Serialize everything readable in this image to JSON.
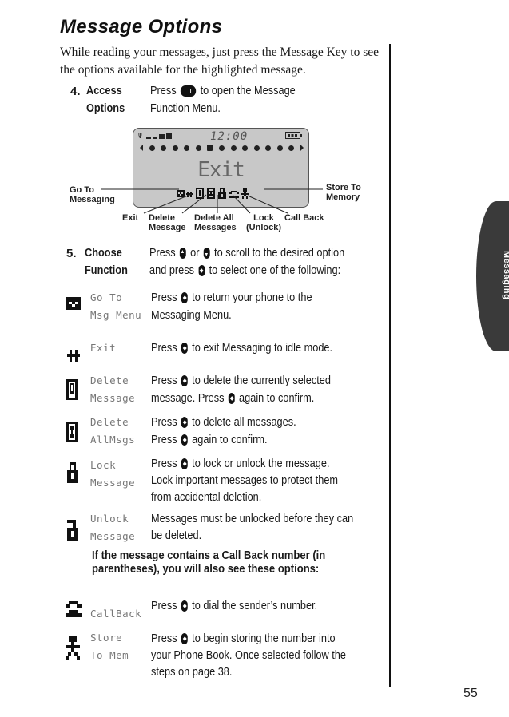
{
  "page": {
    "title": "Message Options",
    "intro": "While reading your messages, just press the Message Key to see the options available for the highlighted message.",
    "page_number": "55",
    "side_tab": "Messaging"
  },
  "step4": {
    "number": "4.",
    "label_line1": "Access",
    "label_line2": "Options",
    "text_before_key": "Press",
    "key_icon": "message-key-icon",
    "text_after_key": "to open the Message",
    "text_line2": "Function Menu."
  },
  "display": {
    "time": "12:00",
    "screen_text": "Exit",
    "callouts": {
      "go_to_messaging": [
        "Go To",
        "Messaging"
      ],
      "store_to_memory": [
        "Store To",
        "Memory"
      ],
      "exit": "Exit",
      "delete_message": [
        "Delete",
        "Message"
      ],
      "delete_all": [
        "Delete All",
        "Messages"
      ],
      "lock": [
        "Lock",
        "(Unlock)"
      ],
      "call_back": "Call Back"
    }
  },
  "step5": {
    "number": "5.",
    "label_line1": "Choose",
    "label_line2": "Function",
    "line1_a": "Press",
    "line1_b": "or",
    "line1_c": "to scroll to the desired option",
    "line2_a": "and press",
    "line2_b": "to select one of the following:"
  },
  "options": [
    {
      "icon": "go-to-messaging-icon",
      "lcd_line1": "Go To",
      "lcd_line2": "Msg Menu",
      "desc": [
        "Press",
        "to return your phone to the",
        "Messaging Menu."
      ]
    },
    {
      "icon": "exit-icon",
      "lcd_line1": "Exit",
      "lcd_line2": "",
      "desc": [
        "Press",
        "to exit Messaging to idle mode."
      ]
    },
    {
      "icon": "delete-message-icon",
      "lcd_line1": "Delete",
      "lcd_line2": "Message",
      "desc": [
        "Press",
        "to delete the currently selected",
        "message. Press",
        "again to confirm."
      ]
    },
    {
      "icon": "delete-all-icon",
      "lcd_line1": "Delete",
      "lcd_line2": "AllMsgs",
      "desc": [
        "Press",
        "to delete all messages.",
        "Press",
        "again to confirm."
      ]
    },
    {
      "icon": "lock-icon",
      "lcd_line1": "Lock",
      "lcd_line2": "Message",
      "desc": [
        "Press",
        "to lock or unlock the message.",
        "Lock important messages to protect them",
        "from accidental deletion."
      ]
    },
    {
      "icon": "unlock-icon",
      "lcd_line1": "Unlock",
      "lcd_line2": "Message",
      "desc": [
        "Messages must be unlocked before they can",
        "be deleted."
      ]
    }
  ],
  "callback_note": [
    "If the message contains a Call Back number (in",
    "parentheses), you will also see these options:"
  ],
  "callback_options": [
    {
      "icon": "call-back-icon",
      "lcd_line1": "",
      "lcd_line2": "CallBack",
      "desc": [
        "Press",
        "to dial the sender’s number."
      ]
    },
    {
      "icon": "store-to-memory-icon",
      "lcd_line1": "Store",
      "lcd_line2": "To Mem",
      "desc": [
        "Press",
        "to begin storing the number into",
        "your Phone Book. Once selected follow the",
        "steps on page 38."
      ]
    }
  ]
}
